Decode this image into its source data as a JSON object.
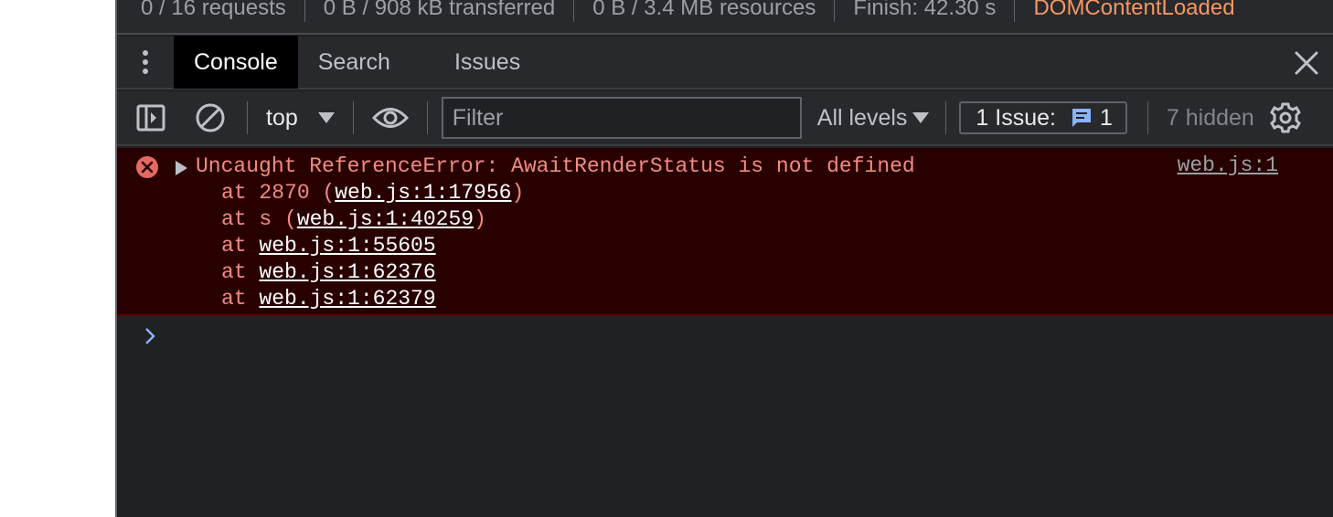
{
  "summary": {
    "requests": "0 / 16 requests",
    "transferred": "0 B / 908 kB transferred",
    "resources": "0 B / 3.4 MB resources",
    "finish": "Finish: 42.30 s",
    "dcl": "DOMContentLoaded",
    "dcl_color": "#f29766"
  },
  "tabs": [
    {
      "label": "Console"
    },
    {
      "label": "Search"
    },
    {
      "label": "Issues"
    }
  ],
  "toolbar": {
    "context": "top",
    "filter_placeholder": "Filter",
    "levels": "All levels",
    "issues_label": "1 Issue:",
    "issues_count": "1",
    "hidden": "7 hidden"
  },
  "error": {
    "message": "Uncaught ReferenceError: AwaitRenderStatus is not defined",
    "source": "web.js:1",
    "stack": [
      {
        "prefix": "at 2870 (",
        "link": "web.js:1:17956",
        "suffix": ")"
      },
      {
        "prefix": "at s (",
        "link": "web.js:1:40259",
        "suffix": ")"
      },
      {
        "prefix": "at ",
        "link": "web.js:1:55605",
        "suffix": ""
      },
      {
        "prefix": "at ",
        "link": "web.js:1:62376",
        "suffix": ""
      },
      {
        "prefix": "at ",
        "link": "web.js:1:62379",
        "suffix": ""
      }
    ],
    "color": "#f28b82"
  },
  "icons": {
    "kebab": "more-vert-icon",
    "close": "close-icon",
    "sidebar": "sidebar-toggle-icon",
    "clear": "clear-console-icon",
    "eye": "live-expression-icon",
    "message": "message-icon",
    "gear": "gear-icon",
    "error": "error-icon",
    "prompt": "chevron-right-icon"
  }
}
